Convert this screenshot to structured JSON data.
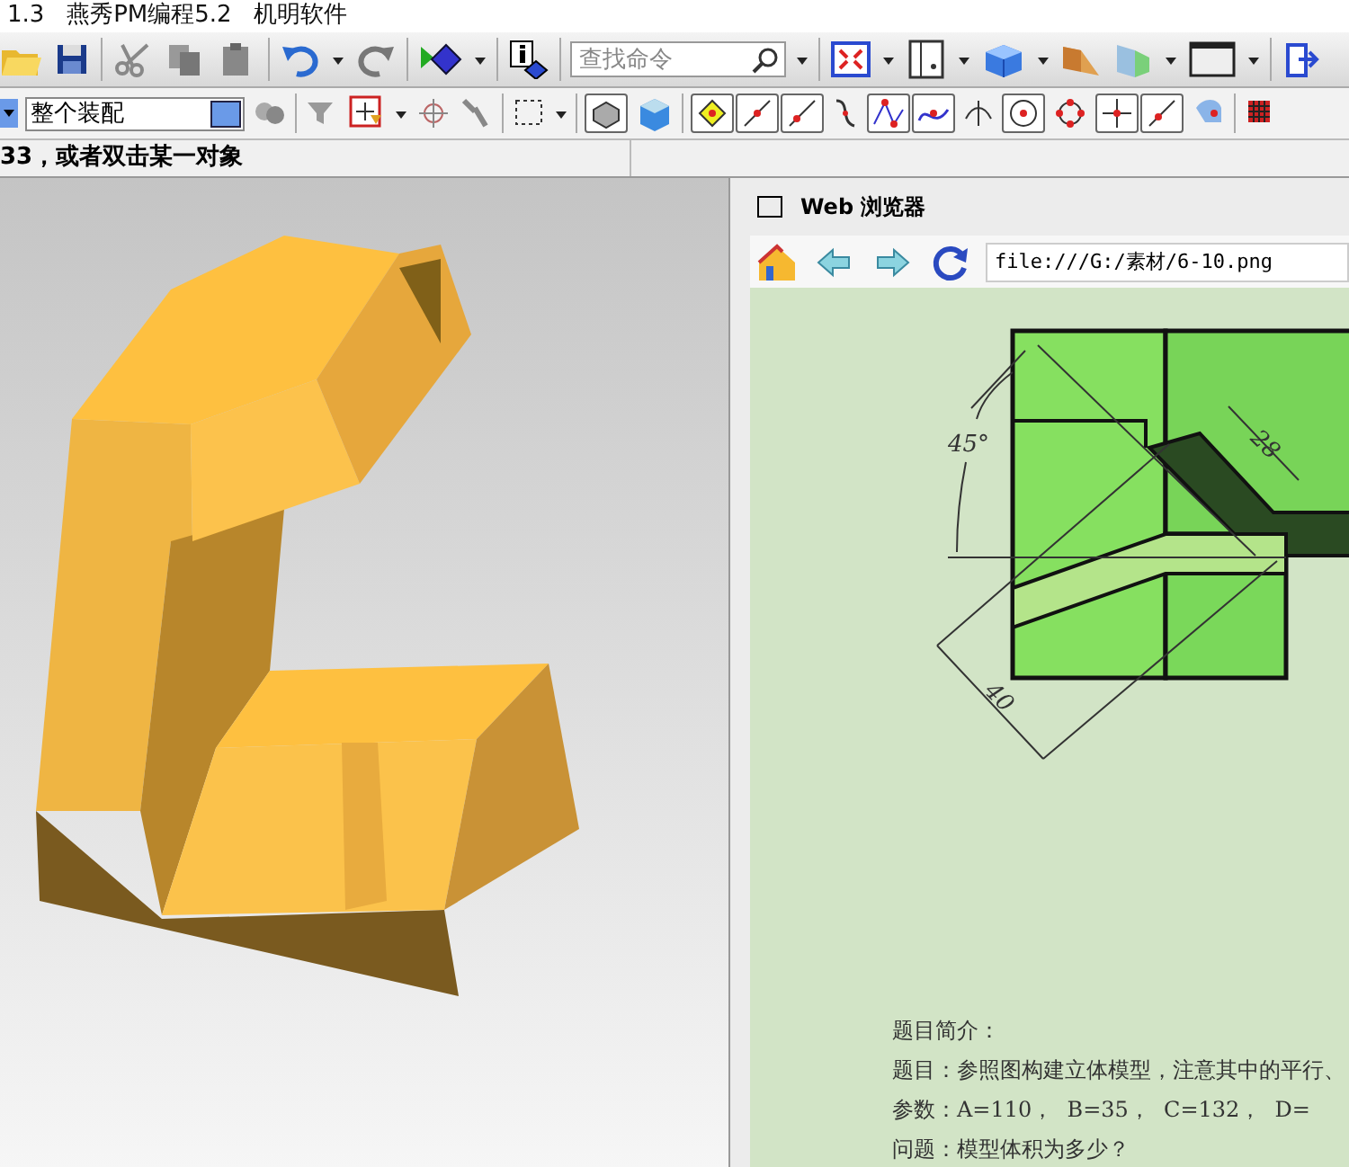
{
  "window": {
    "title": "1.3   燕秀PM编程5.2   机明软件"
  },
  "toolbar": {
    "search": {
      "placeholder": "查找命令"
    }
  },
  "toolbar_2": {
    "assembly_select": {
      "value": "整个装配"
    }
  },
  "status_bar": {
    "prompt": "33，或者双击某一对象"
  },
  "browser": {
    "title": "Web 浏览器",
    "address": "file:///G:/素材/6-10.png",
    "figure_labels": [
      "45°",
      "28",
      "40"
    ],
    "description": [
      "题目简介：",
      "题目：参照图构建立体模型，注意其中的平行、",
      "参数：A=110，  B=35，  C=132，  D=",
      "问题：模型体积为多少？"
    ]
  }
}
